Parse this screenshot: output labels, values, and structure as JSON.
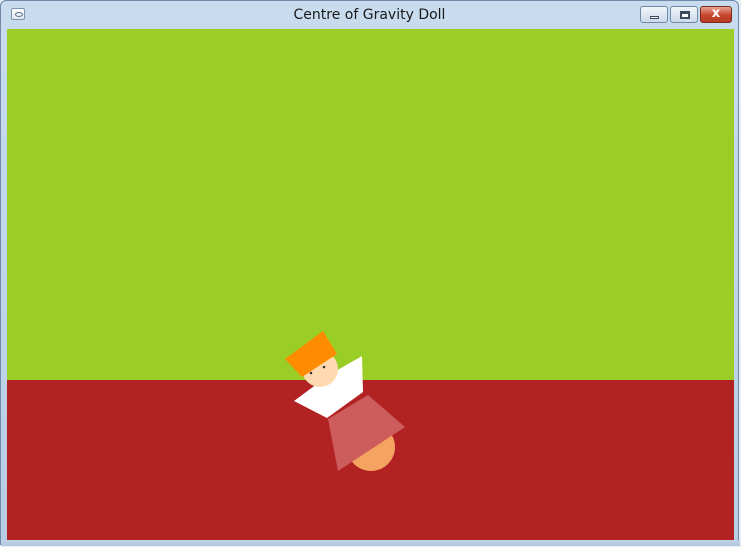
{
  "window": {
    "title": "Centre of Gravity Doll",
    "close_glyph": "x"
  },
  "scene": {
    "colors": {
      "sky": "#9acd26",
      "ground": "#b22222",
      "hat": "#ff8c00",
      "face": "#ffdab0",
      "body": "#ffffff",
      "skirt": "#cd5c5c",
      "base": "#f4a460"
    }
  }
}
